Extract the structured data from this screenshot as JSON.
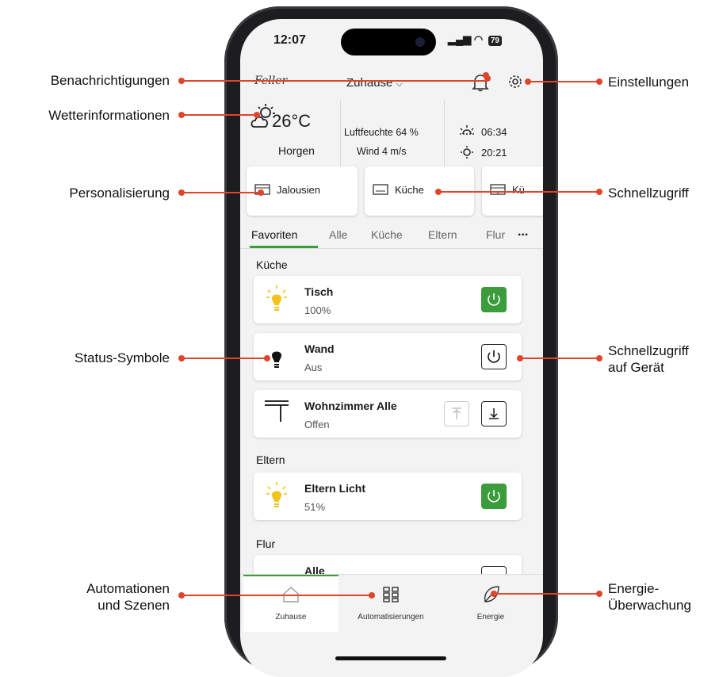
{
  "callouts": {
    "notifications": "Benachrichtigungen",
    "weather": "Wetterinformationen",
    "personalization": "Personalisierung",
    "status_icons": "Status-Symbole",
    "automations_line1": "Automationen",
    "automations_line2": "und Szenen",
    "settings": "Einstellungen",
    "quick_access": "Schnellzugriff",
    "device_quick_line1": "Schnellzugriff",
    "device_quick_line2": "auf Gerät",
    "energy_line1": "Energie-",
    "energy_line2": "Überwachung"
  },
  "accent_color": "#e0442a",
  "status_bar": {
    "time": "12:07",
    "battery": "79"
  },
  "topbar": {
    "logo": "Feller",
    "home": "Zuhause"
  },
  "weather": {
    "temperature": "26°C",
    "location": "Horgen",
    "humidity": "Luftfeuchte 64 %",
    "wind": "Wind 4 m/s",
    "sunrise": "06:34",
    "sunset": "20:21"
  },
  "quick_access": [
    {
      "label": "Jalousien",
      "icon": "blind-icon"
    },
    {
      "label": "Küche",
      "icon": "room-icon"
    },
    {
      "label": "Kü",
      "icon": "blind-icon"
    }
  ],
  "tabs": [
    "Favoriten",
    "Alle",
    "Küche",
    "Eltern",
    "Flur"
  ],
  "tab_more": "...",
  "sections": {
    "kueche": "Küche",
    "eltern": "Eltern",
    "flur": "Flur"
  },
  "devices": {
    "tisch": {
      "name": "Tisch",
      "status": "100%",
      "on": true
    },
    "wand": {
      "name": "Wand",
      "status": "Aus",
      "on": false
    },
    "blinds": {
      "name": "Wohnzimmer Alle",
      "status": "Offen"
    },
    "eltern_licht": {
      "name": "Eltern Licht",
      "status": "51%",
      "on": true
    },
    "flur_partial": {
      "name": "Alle"
    }
  },
  "navbar": {
    "home": "Zuhause",
    "automations": "Automatisierungen",
    "energy": "Energie"
  },
  "colors": {
    "green": "#3a9c3a",
    "bulb_on": "#f0c419"
  }
}
